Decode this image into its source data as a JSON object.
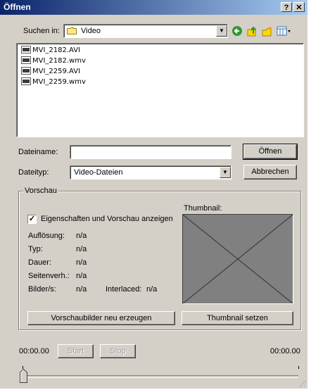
{
  "window": {
    "title": "Öffnen",
    "help_btn": "?",
    "close_btn": "✕"
  },
  "lookin": {
    "label": "Suchen in:",
    "value": "Video"
  },
  "toolbar_icons": [
    "back-icon",
    "up-folder-icon",
    "new-folder-icon",
    "view-menu-icon"
  ],
  "files": [
    {
      "name": "MVI_2182.AVI"
    },
    {
      "name": "MVI_2182.wmv"
    },
    {
      "name": "MVI_2259.AVI"
    },
    {
      "name": "MVI_2259.wmv"
    }
  ],
  "filename": {
    "label": "Dateiname:",
    "value": ""
  },
  "filetype": {
    "label": "Dateityp:",
    "value": "Video-Dateien"
  },
  "buttons": {
    "open": "Öffnen",
    "cancel": "Abbrechen"
  },
  "preview": {
    "group_label": "Vorschau",
    "checkbox_label": "Eigenschaften und Vorschau anzeigen",
    "checked": true,
    "thumbnail_label": "Thumbnail:",
    "props": {
      "resolution_label": "Auflösung:",
      "resolution_value": "n/a",
      "type_label": "Typ:",
      "type_value": "n/a",
      "duration_label": "Dauer:",
      "duration_value": "n/a",
      "aspect_label": "Seitenverh.:",
      "aspect_value": "n/a",
      "fps_label": "Bilder/s:",
      "fps_value": "n/a",
      "interlaced_label": "Interlaced:",
      "interlaced_value": "n/a"
    },
    "gen_button": "Vorschaubilder neu erzeugen",
    "set_thumb_button": "Thumbnail setzen"
  },
  "player": {
    "time_start": "00:00.00",
    "time_end": "00:00.00",
    "start": "Start",
    "stop": "Stop",
    "position": 0
  },
  "colors": {
    "title_gradient_start": "#0a246a",
    "title_gradient_end": "#a6caf0",
    "dialog_bg": "#d4d0c8",
    "thumb_bg": "#808080"
  }
}
